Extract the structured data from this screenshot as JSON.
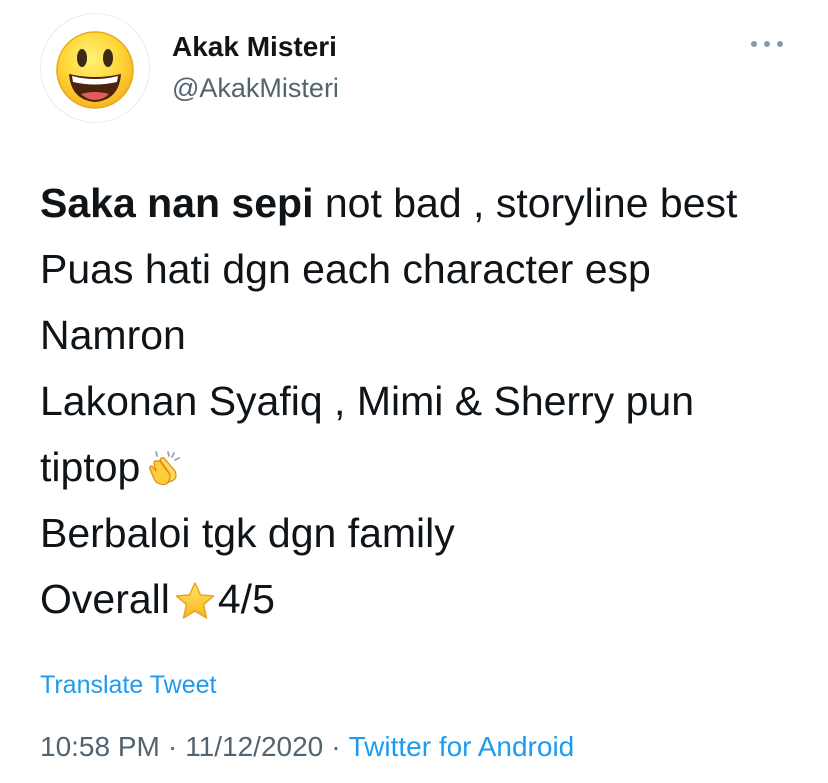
{
  "user": {
    "display_name": "Akak Misteri",
    "handle": "@AkakMisteri",
    "avatar_icon": "grinning-face-icon"
  },
  "more_icon": "more-horizontal-icon",
  "tweet": {
    "line1_bold": "Saka nan sepi",
    "line1_rest": " not bad , storyline best",
    "line2": "Puas hati dgn each character esp",
    "line3": "Namron",
    "line4": "Lakonan Syafiq , Mimi & Sherry pun",
    "line5": "tiptop",
    "line5_emoji": "clapping-hands-icon",
    "line6": "Berbaloi tgk dgn family",
    "line7_prefix": "Overall",
    "line7_emoji": "star-icon",
    "line7_rating": "4/5"
  },
  "translate_label": "Translate Tweet",
  "meta": {
    "time": "10:58 PM",
    "separator": "·",
    "date": "11/12/2020",
    "source": "Twitter for Android"
  },
  "colors": {
    "link": "#1d9bf0",
    "secondary": "#536471",
    "primary": "#0f1419"
  }
}
